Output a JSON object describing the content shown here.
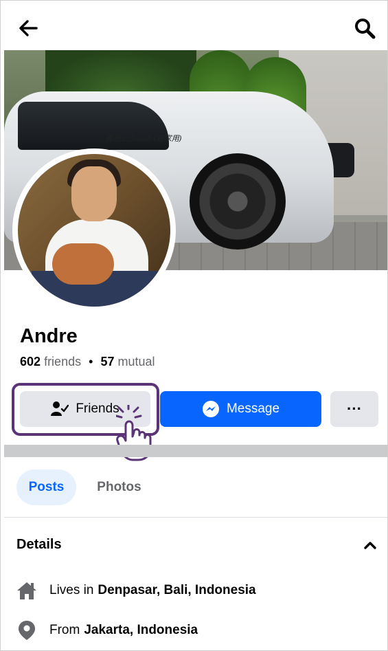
{
  "header": {
    "back_icon": "arrow-left-icon",
    "search_icon": "search-icon"
  },
  "cover": {
    "car_text": "藤原とうふ店 (自家用)"
  },
  "profile": {
    "name": "Andre",
    "friends_count": "602",
    "friends_label": "friends",
    "separator": "•",
    "mutual_count": "57",
    "mutual_label": "mutual"
  },
  "actions": {
    "friends_label": "Friends",
    "message_label": "Message",
    "more_label": "···"
  },
  "tabs": [
    {
      "label": "Posts",
      "active": true
    },
    {
      "label": "Photos",
      "active": false
    }
  ],
  "details": {
    "title": "Details",
    "items": [
      {
        "icon": "home-icon",
        "prefix": "Lives in",
        "value": "Denpasar, Bali, Indonesia"
      },
      {
        "icon": "location-pin-icon",
        "prefix": "From",
        "value": "Jakarta, Indonesia"
      }
    ]
  },
  "colors": {
    "accent": "#0866ff",
    "highlight": "#5b3478",
    "button_gray": "#e4e6eb",
    "text_secondary": "#65676b"
  }
}
